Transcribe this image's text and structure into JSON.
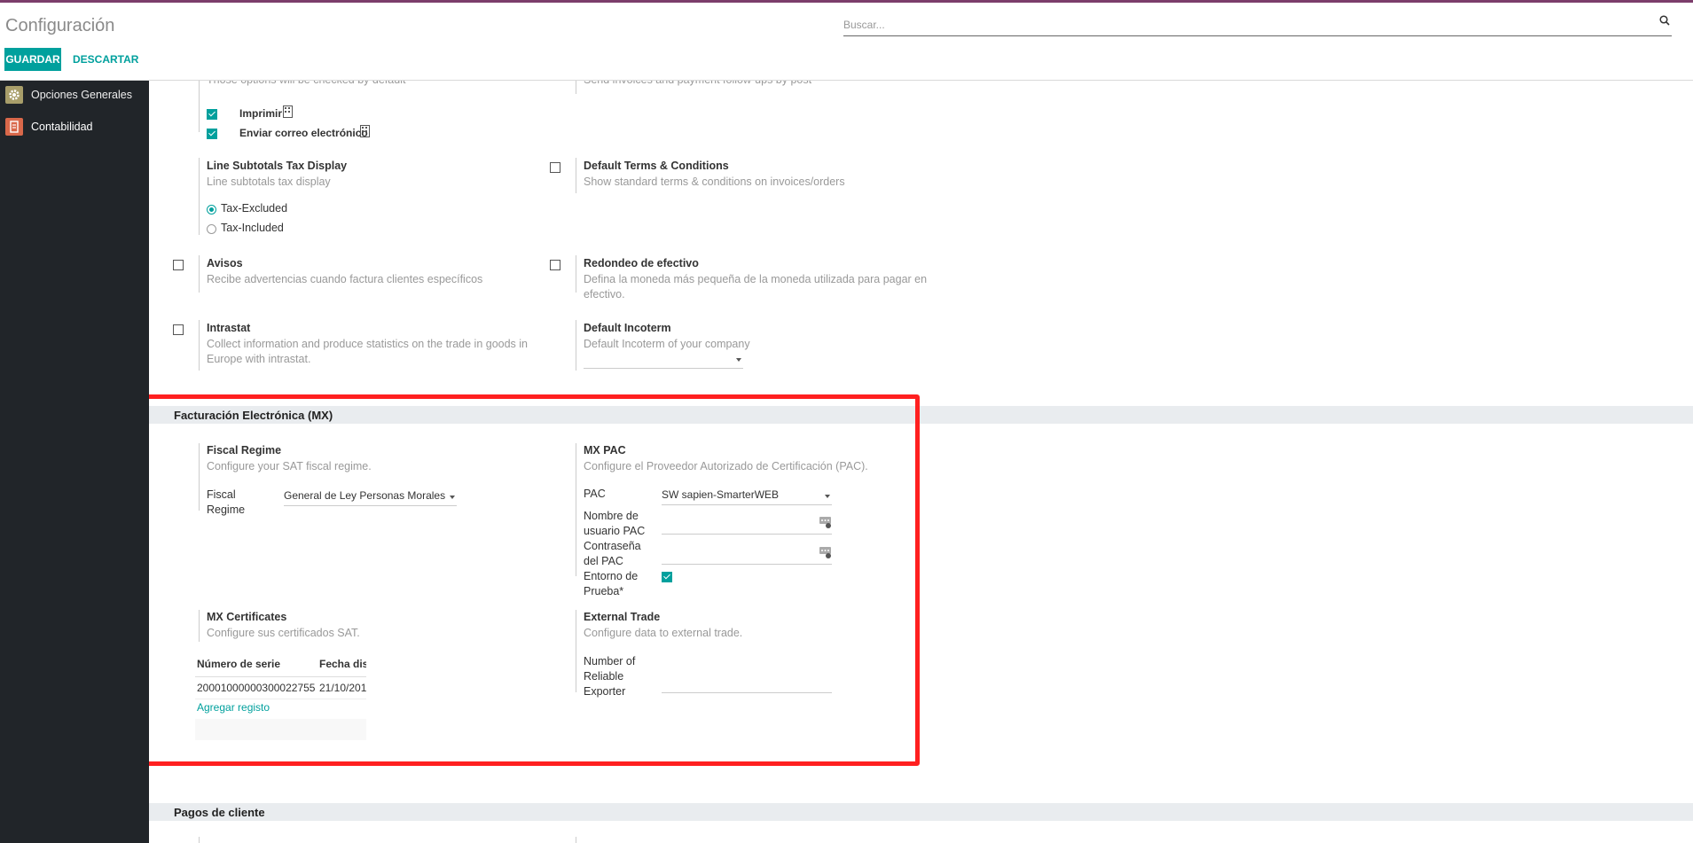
{
  "header": {
    "title": "Configuración",
    "search_placeholder": "Buscar...",
    "save_label": "GUARDAR",
    "discard_label": "DESCARTAR"
  },
  "sidebar": {
    "items": [
      {
        "label": "Opciones Generales",
        "icon": "gear-icon",
        "color": "#a89e6a"
      },
      {
        "label": "Contabilidad",
        "icon": "invoice-icon",
        "color": "#d9684a"
      }
    ]
  },
  "defaults": {
    "desc_left": "Those options will be checked by default",
    "desc_right": "Send invoices and payment follow-ups by post",
    "print_label": "Imprimir",
    "email_label": "Enviar correo electrónico",
    "print_checked": true,
    "email_checked": true
  },
  "line_subtotals": {
    "title": "Line Subtotals Tax Display",
    "desc": "Line subtotals tax display",
    "options": [
      "Tax-Excluded",
      "Tax-Included"
    ],
    "selected": "Tax-Excluded"
  },
  "default_terms": {
    "title": "Default Terms & Conditions",
    "desc": "Show standard terms & conditions on invoices/orders",
    "checked": false
  },
  "avisos": {
    "title": "Avisos",
    "desc": "Recibe advertencias cuando factura clientes específicos",
    "checked": false
  },
  "redondeo": {
    "title": "Redondeo de efectivo",
    "desc_line1": "Defina la moneda más pequeña de la moneda utilizada para pagar en",
    "desc_line2": "efectivo.",
    "checked": false
  },
  "intrastat": {
    "title": "Intrastat",
    "desc_line1": "Collect information and produce statistics on the trade in goods in",
    "desc_line2": "Europe with intrastat.",
    "checked": false
  },
  "incoterm": {
    "title": "Default Incoterm",
    "desc": "Default Incoterm of your company",
    "value": ""
  },
  "mx_section": {
    "title": "Facturación Electrónica (MX)",
    "fiscal_regime": {
      "title": "Fiscal Regime",
      "desc": "Configure your SAT fiscal regime.",
      "field_label_1": "Fiscal",
      "field_label_2": "Regime",
      "value": "General de Ley Personas Morales"
    },
    "mx_pac": {
      "title": "MX PAC",
      "desc": "Configure el Proveedor Autorizado de Certificación (PAC).",
      "pac_label": "PAC",
      "pac_value": "SW sapien-SmarterWEB",
      "user_label_1": "Nombre de",
      "user_label_2": "usuario PAC",
      "user_value": "",
      "pass_label_1": "Contraseña",
      "pass_label_2": "del PAC",
      "pass_value": "",
      "test_label_1": "Entorno de",
      "test_label_2": "Prueba*",
      "test_checked": true
    },
    "certificates": {
      "title": "MX Certificates",
      "desc": "Configure sus certificados SAT.",
      "columns": [
        "Número de serie",
        "Fecha dis"
      ],
      "rows": [
        [
          "20001000000300022755",
          "21/10/201"
        ]
      ],
      "add_label": "Agregar registo"
    },
    "external_trade": {
      "title": "External Trade",
      "desc": "Configure data to external trade.",
      "label_1": "Number of",
      "label_2": "Reliable",
      "label_3": "Exporter",
      "value": ""
    }
  },
  "pagos_section": {
    "title": "Pagos de cliente"
  },
  "colors": {
    "accent": "#00a09d",
    "brand_bar": "#7c3d6b",
    "highlight": "#ff2020"
  }
}
